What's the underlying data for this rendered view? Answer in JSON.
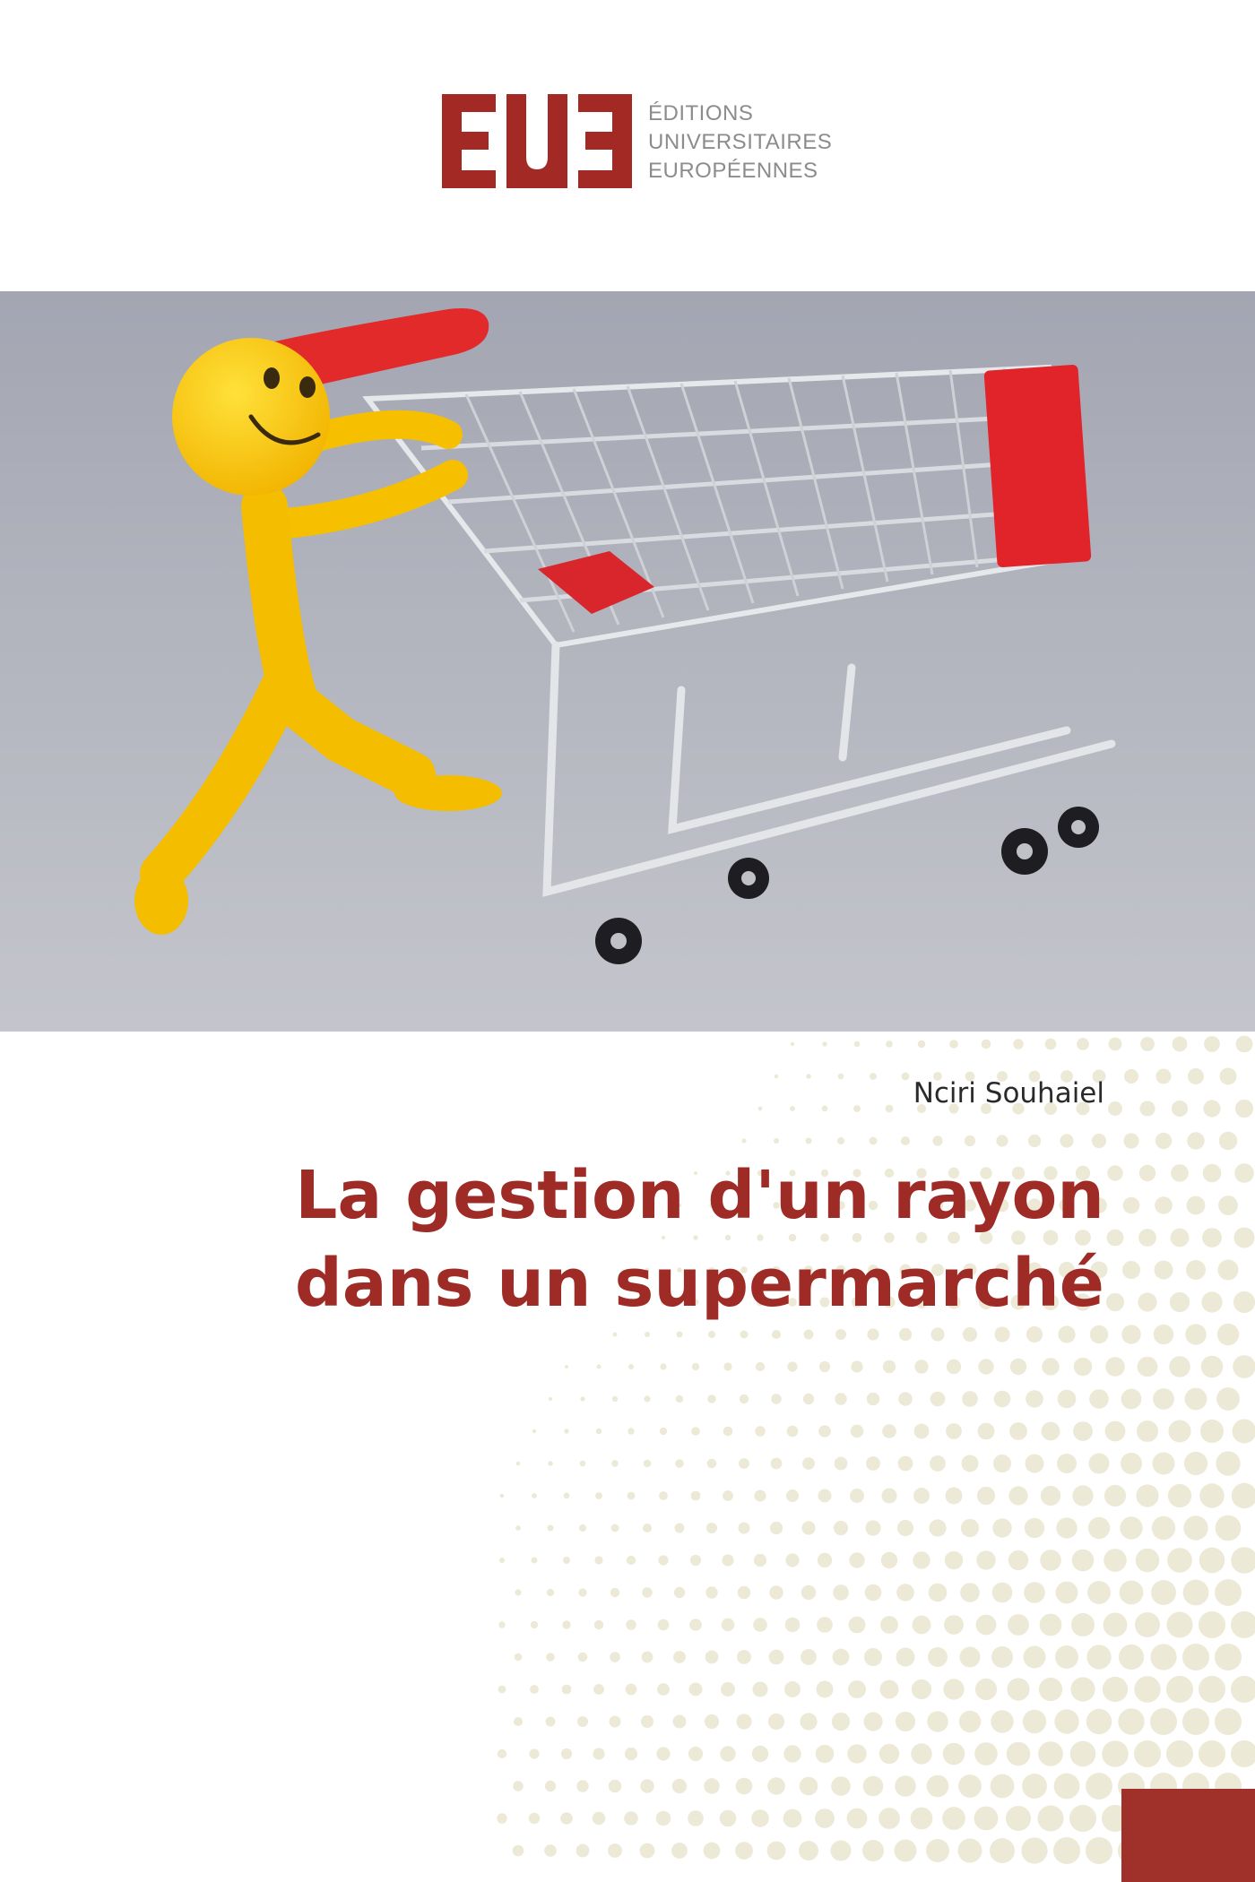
{
  "publisher": {
    "lines": [
      "ÉDITIONS",
      "UNIVERSITAIRES",
      "EUROPÉENNES"
    ],
    "brand_color": "#a32a24"
  },
  "book": {
    "author": "Nciri Souhaiel",
    "title_lines": [
      "La gestion d'un rayon",
      "dans un supermarché"
    ],
    "title_color": "#9e2b25"
  },
  "cover_image": {
    "subject": "yellow smiley figure pushing a shopping cart",
    "background_color": "#a9abb5"
  },
  "decoration": {
    "dot_color": "#ece9d6",
    "corner_color": "#a0302a"
  }
}
